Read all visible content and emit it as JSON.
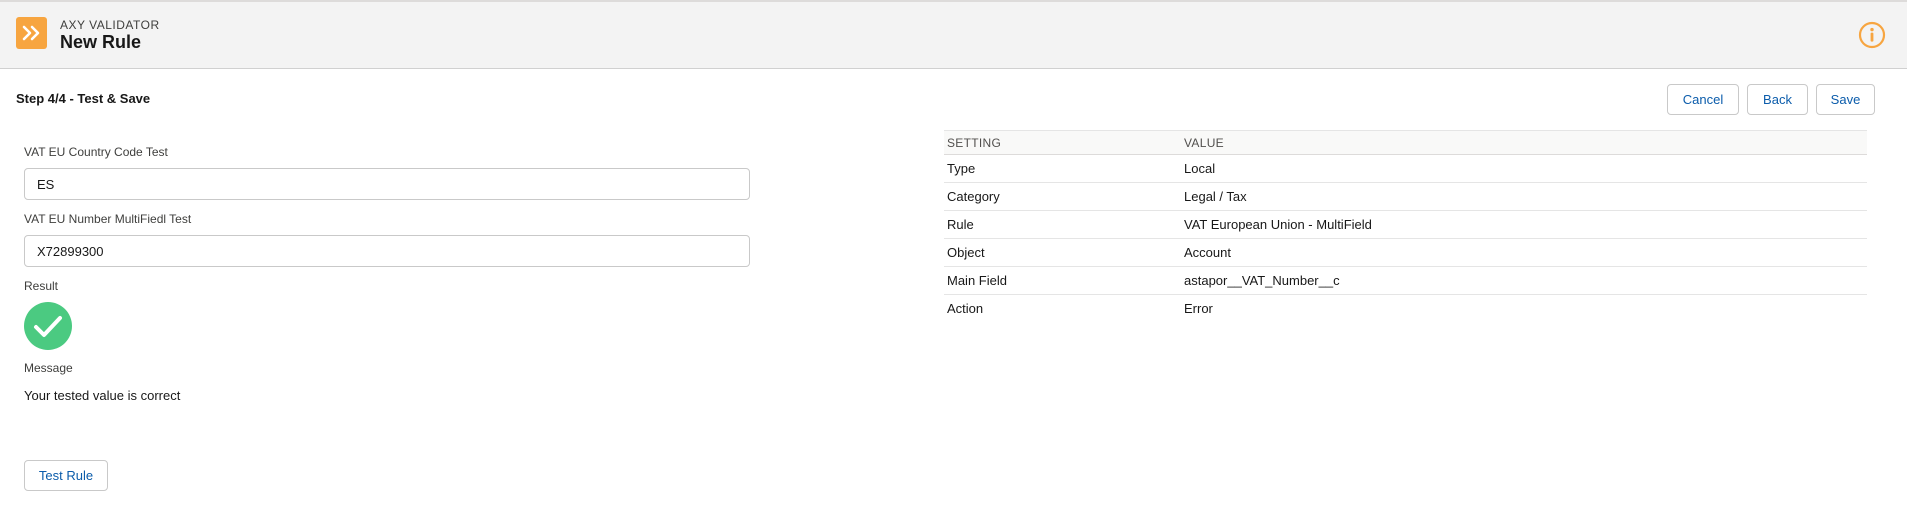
{
  "header": {
    "eyebrow": "AXY VALIDATOR",
    "title": "New Rule",
    "app_icon": "double-chevron-right-icon",
    "info_icon": "info-icon",
    "accent_color": "#f7a540"
  },
  "step": {
    "title": "Step 4/4 - Test & Save"
  },
  "actions": {
    "cancel": "Cancel",
    "back": "Back",
    "save": "Save"
  },
  "form": {
    "country_label": "VAT EU Country Code Test",
    "country_value": "ES",
    "number_label": "VAT EU Number MultiFiedl Test",
    "number_value": "X72899300",
    "result_label": "Result",
    "result_icon": "check-circle-icon",
    "result_color": "#4bca81",
    "message_label": "Message",
    "message_text": "Your tested value is correct",
    "test_button": "Test Rule"
  },
  "settings": {
    "headers": [
      "SETTING",
      "VALUE"
    ],
    "rows": [
      {
        "setting": "Type",
        "value": "Local"
      },
      {
        "setting": "Category",
        "value": "Legal / Tax"
      },
      {
        "setting": "Rule",
        "value": "VAT European Union - MultiField"
      },
      {
        "setting": "Object",
        "value": "Account"
      },
      {
        "setting": "Main Field",
        "value": "astapor__VAT_Number__c"
      },
      {
        "setting": "Action",
        "value": "Error"
      }
    ]
  }
}
